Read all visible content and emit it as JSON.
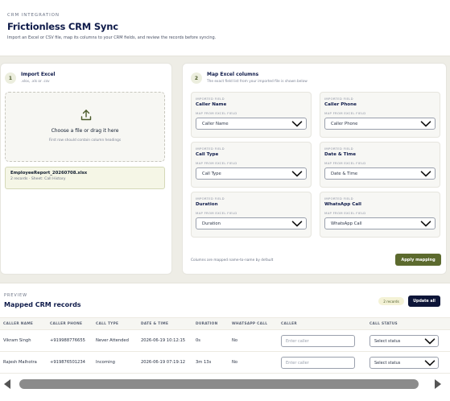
{
  "header": {
    "eyebrow": "CRM INTEGRATION",
    "title": "Frictionless CRM Sync",
    "subtitle": "Import an Excel or CSV file, map its columns to your CRM fields, and review the records before syncing."
  },
  "import": {
    "step": "1",
    "title": "Import Excel",
    "formats": ".xlsx, .xls or .csv",
    "drop_title": "Choose a file or drag it here",
    "drop_hint": "First row should contain column headings",
    "file_name": "EmployeeReport_20260708.xlsx",
    "file_meta": "2 records · Sheet: Call History"
  },
  "mapping": {
    "step": "2",
    "title": "Map Excel columns",
    "subtitle": "The exact field list from your imported file is shown below",
    "imported_tag": "IMPORTED FIELD",
    "map_tag": "MAP FROM EXCEL FIELD",
    "fields": [
      {
        "name": "Caller Name",
        "selected": "Caller Name"
      },
      {
        "name": "Caller Phone",
        "selected": "Caller Phone"
      },
      {
        "name": "Call Type",
        "selected": "Call Type"
      },
      {
        "name": "Date & Time",
        "selected": "Date & Time"
      },
      {
        "name": "Duration",
        "selected": "Duration"
      },
      {
        "name": "WhatsApp Call",
        "selected": "WhatsApp Call"
      }
    ],
    "note": "Columns are mapped name-to-name by default",
    "apply_label": "Apply mapping"
  },
  "preview": {
    "eyebrow": "PREVIEW",
    "title": "Mapped CRM records",
    "badge": "2 records",
    "update_label": "Update all",
    "columns": [
      "CALLER NAME",
      "CALLER PHONE",
      "CALL TYPE",
      "DATE & TIME",
      "DURATION",
      "WHATSAPP CALL",
      "CALLER",
      "CALL STATUS"
    ],
    "rows": [
      {
        "name": "Vikram Singh",
        "phone": "+919988776655",
        "type": "Never Attended",
        "datetime": "2026-06-19 10:12:15",
        "duration": "0s",
        "whatsapp": "No",
        "caller_placeholder": "Enter caller",
        "status": "Select status"
      },
      {
        "name": "Rajesh Malhotra",
        "phone": "+919876501234",
        "type": "Incoming",
        "datetime": "2026-06-19 07:19:12",
        "duration": "3m 13s",
        "whatsapp": "No",
        "caller_placeholder": "Enter caller",
        "status": "Select status"
      }
    ]
  },
  "icons": {
    "upload": "upload-icon",
    "chevron": "chevron-down-icon",
    "scroll_left": "scroll-left-arrow-icon",
    "scroll_right": "scroll-right-arrow-icon"
  },
  "colors": {
    "accent": "#5c6a2e",
    "primary_dark": "#0d1538",
    "background": "#eeede6"
  }
}
